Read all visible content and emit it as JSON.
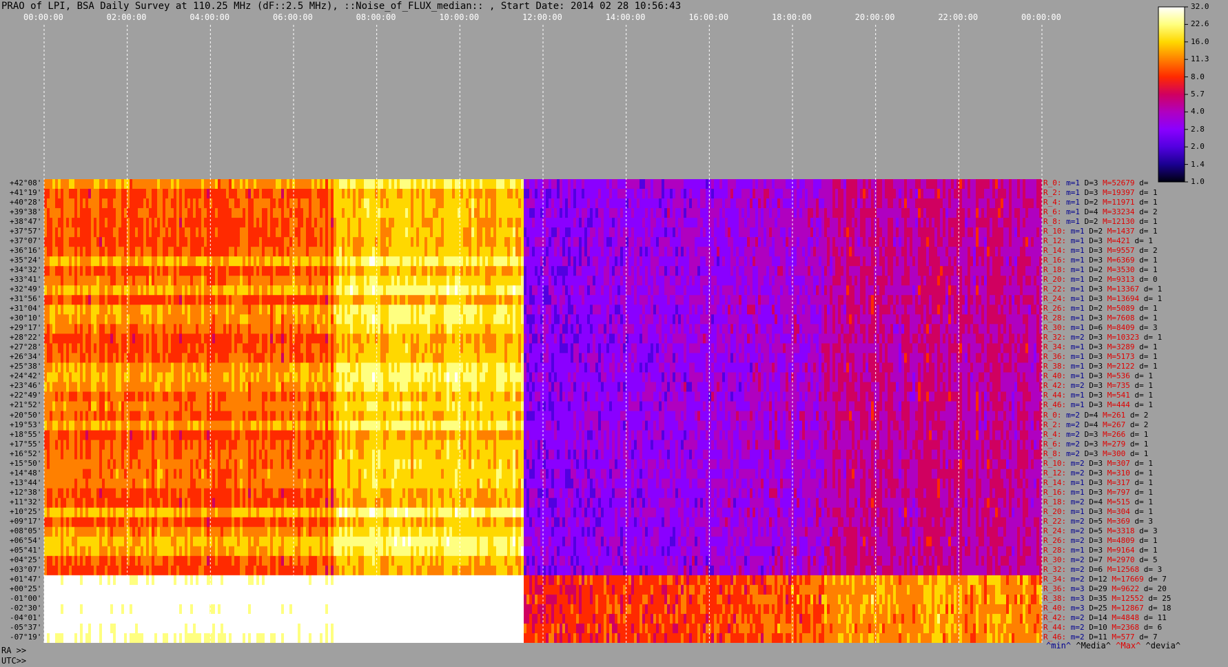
{
  "title": "PRAO of LPI, BSA Daily Survey at 110.25 MHz (dF::2.5 MHz), ::Noise_of_FLUX_median:: , Start Date: 2014 02 28 10:56:43",
  "colorbar": {
    "ticks": [
      "32.0",
      "22.6",
      "16.0",
      "11.3",
      "8.0",
      "5.7",
      "4.0",
      "2.8",
      "2.0",
      "1.4",
      "1.0"
    ],
    "colors": [
      "#ffffff",
      "#ffff80",
      "#ffd800",
      "#ff8000",
      "#ff2a00",
      "#d00060",
      "#b000c0",
      "#8a00ff",
      "#5200e0",
      "#1a0090",
      "#000010"
    ]
  },
  "axis_labels": {
    "ra": "RA >>",
    "utc": "UTC>>"
  },
  "stats_legend": {
    "min": "^min^",
    "media": "^Media^",
    "max": "^Max^",
    "devia": "^devia^"
  },
  "chart_data": {
    "type": "heatmap",
    "title": "PRAO of LPI, BSA Daily Survey at 110.25 MHz (dF::2.5 MHz), ::Noise_of_FLUX_median:: , Start Date: 2014 02 28 10:56:43",
    "x_top_ticks": [
      "00:00:00",
      "02:00:00",
      "04:00:00",
      "06:00:00",
      "08:00:00",
      "10:00:00",
      "12:00:00",
      "14:00:00",
      "16:00:00",
      "18:00:00",
      "20:00:00",
      "22:00:00",
      "00:00:00"
    ],
    "x_ra_ticks": [
      "00:00:00",
      "02:00:00",
      "04:00:00",
      "06:00:00",
      "08:00:00",
      "10:00:00",
      "12:00:00",
      "14:00:00",
      "16:00:00",
      "18:00:00",
      "20:00:00",
      "22:00:00",
      "00:00:00"
    ],
    "x_utc_ticks": [
      "12:00:00",
      "14:00:00",
      "16:00:00",
      "18:00:00",
      "20:00:00",
      "22:00:00",
      "00:00:00",
      "02:00:00",
      "04:00:00",
      "06:00:00",
      "08:00:00",
      "10:00:00"
    ],
    "declinations": [
      "+42°08'",
      "+41°19'",
      "+40°28'",
      "+39°38'",
      "+38°47'",
      "+37°57'",
      "+37°07'",
      "+36°16'",
      "+35°24'",
      "+34°32'",
      "+33°41'",
      "+32°49'",
      "+31°56'",
      "+31°04'",
      "+30°10'",
      "+29°17'",
      "+28°22'",
      "+27°28'",
      "+26°34'",
      "+25°38'",
      "+24°42'",
      "+23°46'",
      "+22°49'",
      "+21°52'",
      "+20°50'",
      "+19°53'",
      "+18°55'",
      "+17°55'",
      "+16°52'",
      "+15°50'",
      "+14°48'",
      "+13°44'",
      "+12°38'",
      "+11°32'",
      "+10°25'",
      "+09°17'",
      "+08°05'",
      "+06°54'",
      "+05°41'",
      "+04°25'",
      "+03°07'",
      "+01°47'",
      "+00°25'",
      "-01°00'",
      "-02°30'",
      "-04°01'",
      "-05°37'",
      "-07°19'"
    ],
    "rows": [
      {
        "r": "R_0:",
        "m": "m=1",
        "D": "D=3",
        "M": "M=52679",
        "d": "d="
      },
      {
        "r": "R_2:",
        "m": "m=1",
        "D": "D=3",
        "M": "M=19397",
        "d": "d= 1"
      },
      {
        "r": "R_4:",
        "m": "m=1",
        "D": "D=2",
        "M": "M=11971",
        "d": "d= 1"
      },
      {
        "r": "R_6:",
        "m": "m=1",
        "D": "D=4",
        "M": "M=33234",
        "d": "d= 2"
      },
      {
        "r": "R_8:",
        "m": "m=1",
        "D": "D=2",
        "M": "M=12130",
        "d": "d= 1"
      },
      {
        "r": "R_10:",
        "m": "m=1",
        "D": "D=2",
        "M": "M=1437",
        "d": "d= 1"
      },
      {
        "r": "R_12:",
        "m": "m=1",
        "D": "D=3",
        "M": "M=421",
        "d": "d= 1"
      },
      {
        "r": "R_14:",
        "m": "m=1",
        "D": "D=3",
        "M": "M=9557",
        "d": "d= 2"
      },
      {
        "r": "R_16:",
        "m": "m=1",
        "D": "D=3",
        "M": "M=6369",
        "d": "d= 1"
      },
      {
        "r": "R_18:",
        "m": "m=1",
        "D": "D=2",
        "M": "M=3530",
        "d": "d= 1"
      },
      {
        "r": "R_20:",
        "m": "m=1",
        "D": "D=2",
        "M": "M=9313",
        "d": "d= 0"
      },
      {
        "r": "R_22:",
        "m": "m=1",
        "D": "D=3",
        "M": "M=13367",
        "d": "d= 1"
      },
      {
        "r": "R_24:",
        "m": "m=1",
        "D": "D=3",
        "M": "M=13694",
        "d": "d= 1"
      },
      {
        "r": "R_26:",
        "m": "m=1",
        "D": "D=2",
        "M": "M=5089",
        "d": "d= 1"
      },
      {
        "r": "R_28:",
        "m": "m=1",
        "D": "D=3",
        "M": "M=7608",
        "d": "d= 1"
      },
      {
        "r": "R_30:",
        "m": "m=1",
        "D": "D=6",
        "M": "M=8409",
        "d": "d= 3"
      },
      {
        "r": "R_32:",
        "m": "m=2",
        "D": "D=3",
        "M": "M=10323",
        "d": "d= 1"
      },
      {
        "r": "R_34:",
        "m": "m=1",
        "D": "D=3",
        "M": "M=3289",
        "d": "d= 1"
      },
      {
        "r": "R_36:",
        "m": "m=1",
        "D": "D=3",
        "M": "M=5173",
        "d": "d= 1"
      },
      {
        "r": "R_38:",
        "m": "m=1",
        "D": "D=3",
        "M": "M=2122",
        "d": "d= 1"
      },
      {
        "r": "R_40:",
        "m": "m=1",
        "D": "D=3",
        "M": "M=536",
        "d": "d= 1"
      },
      {
        "r": "R_42:",
        "m": "m=2",
        "D": "D=3",
        "M": "M=735",
        "d": "d= 1"
      },
      {
        "r": "R_44:",
        "m": "m=1",
        "D": "D=3",
        "M": "M=541",
        "d": "d= 1"
      },
      {
        "r": "R_46:",
        "m": "m=1",
        "D": "D=3",
        "M": "M=444",
        "d": "d= 1"
      },
      {
        "r": "R_0:",
        "m": "m=2",
        "D": "D=4",
        "M": "M=261",
        "d": "d= 2"
      },
      {
        "r": "R_2:",
        "m": "m=2",
        "D": "D=4",
        "M": "M=267",
        "d": "d= 2"
      },
      {
        "r": "R_4:",
        "m": "m=2",
        "D": "D=3",
        "M": "M=266",
        "d": "d= 1"
      },
      {
        "r": "R_6:",
        "m": "m=2",
        "D": "D=3",
        "M": "M=279",
        "d": "d= 1"
      },
      {
        "r": "R_8:",
        "m": "m=2",
        "D": "D=3",
        "M": "M=300",
        "d": "d= 1"
      },
      {
        "r": "R_10:",
        "m": "m=2",
        "D": "D=3",
        "M": "M=307",
        "d": "d= 1"
      },
      {
        "r": "R_12:",
        "m": "m=2",
        "D": "D=3",
        "M": "M=310",
        "d": "d= 1"
      },
      {
        "r": "R_14:",
        "m": "m=1",
        "D": "D=3",
        "M": "M=317",
        "d": "d= 1"
      },
      {
        "r": "R_16:",
        "m": "m=1",
        "D": "D=3",
        "M": "M=797",
        "d": "d= 1"
      },
      {
        "r": "R_18:",
        "m": "m=2",
        "D": "D=4",
        "M": "M=515",
        "d": "d= 1"
      },
      {
        "r": "R_20:",
        "m": "m=1",
        "D": "D=3",
        "M": "M=304",
        "d": "d= 1"
      },
      {
        "r": "R_22:",
        "m": "m=2",
        "D": "D=5",
        "M": "M=369",
        "d": "d= 3"
      },
      {
        "r": "R_24:",
        "m": "m=2",
        "D": "D=5",
        "M": "M=3318",
        "d": "d= 3"
      },
      {
        "r": "R_26:",
        "m": "m=2",
        "D": "D=3",
        "M": "M=4809",
        "d": "d= 1"
      },
      {
        "r": "R_28:",
        "m": "m=1",
        "D": "D=3",
        "M": "M=9164",
        "d": "d= 1"
      },
      {
        "r": "R_30:",
        "m": "m=2",
        "D": "D=7",
        "M": "M=2970",
        "d": "d= 5"
      },
      {
        "r": "R_32:",
        "m": "m=2",
        "D": "D=6",
        "M": "M=12568",
        "d": "d= 3"
      },
      {
        "r": "R_34:",
        "m": "m=2",
        "D": "D=12",
        "M": "M=17669",
        "d": "d= 7"
      },
      {
        "r": "R_36:",
        "m": "m=3",
        "D": "D=29",
        "M": "M=9622",
        "d": "d= 20"
      },
      {
        "r": "R_38:",
        "m": "m=3",
        "D": "D=35",
        "M": "M=12552",
        "d": "d= 25"
      },
      {
        "r": "R_40:",
        "m": "m=3",
        "D": "D=25",
        "M": "M=12867",
        "d": "d= 18"
      },
      {
        "r": "R_42:",
        "m": "m=2",
        "D": "D=14",
        "M": "M=4848",
        "d": "d= 11"
      },
      {
        "r": "R_44:",
        "m": "m=2",
        "D": "D=10",
        "M": "M=2368",
        "d": "d= 6"
      },
      {
        "r": "R_46:",
        "m": "m=2",
        "D": "D=11",
        "M": "M=577",
        "d": "d= 7"
      }
    ]
  }
}
